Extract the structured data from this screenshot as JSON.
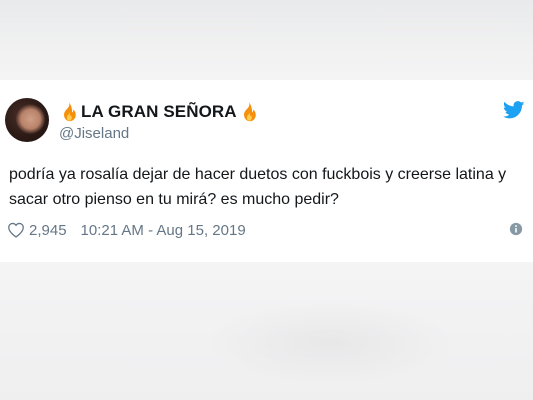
{
  "tweet": {
    "display_name": "LA GRAN SEÑORA",
    "name_emoji": "fire-icon",
    "handle": "@Jiseland",
    "text": "podría ya rosalía dejar de hacer duetos con fuckbois y creerse latina y sacar otro pienso en tu mirá? es mucho pedir?",
    "likes": "2,945",
    "timestamp": "10:21 AM - Aug 15, 2019"
  },
  "colors": {
    "twitter_blue": "#1da1f2",
    "text_primary": "#14171a",
    "text_secondary": "#657786",
    "flame_orange": "#f4900c",
    "flame_yellow": "#ffcc4d"
  },
  "icons": [
    "fire-icon",
    "twitter-bird-icon",
    "heart-icon",
    "info-icon"
  ]
}
